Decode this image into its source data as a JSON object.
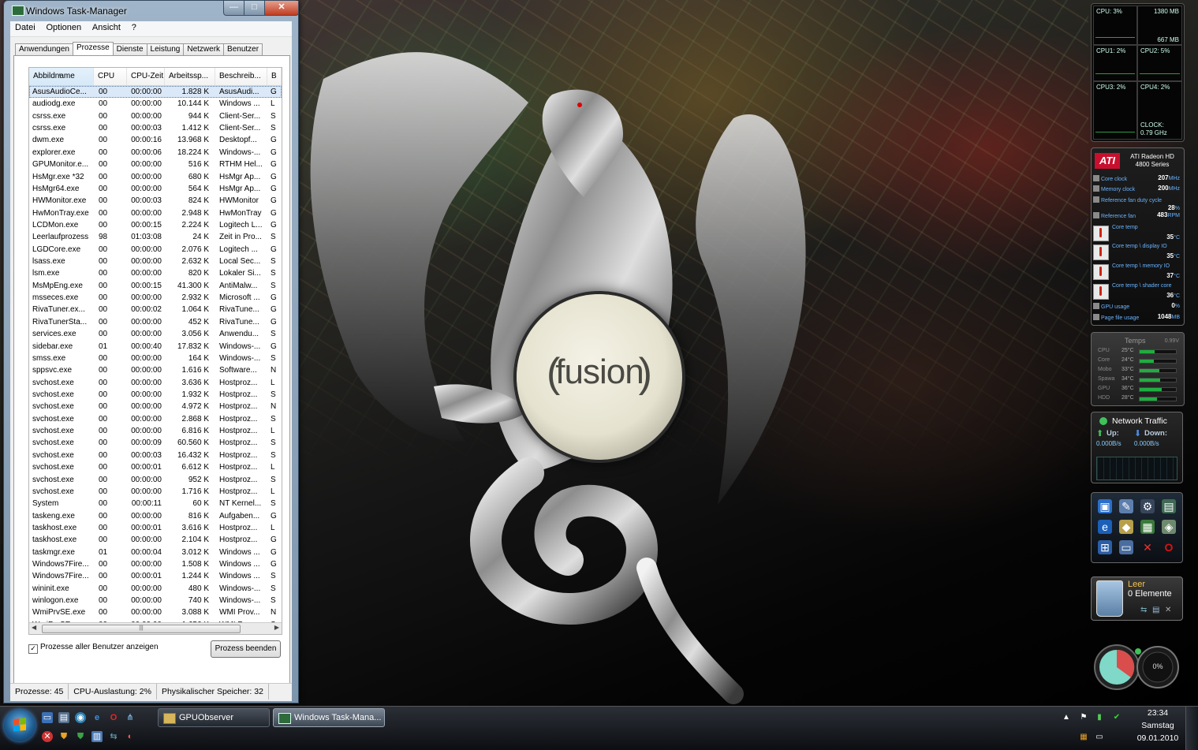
{
  "task_manager": {
    "title": "Windows Task-Manager",
    "title_buttons": {
      "minimize": "—",
      "maximize": "□",
      "close": "✕"
    },
    "menu": [
      "Datei",
      "Optionen",
      "Ansicht",
      "?"
    ],
    "tabs": [
      "Anwendungen",
      "Prozesse",
      "Dienste",
      "Leistung",
      "Netzwerk",
      "Benutzer"
    ],
    "active_tab": "Prozesse",
    "columns": [
      "Abbildname",
      "CPU",
      "CPU-Zeit",
      "Arbeitssp...",
      "Beschreib...",
      "B"
    ],
    "rows": [
      [
        "AsusAudioCe...",
        "00",
        "00:00:00",
        "1.828 K",
        "AsusAudi...",
        "G"
      ],
      [
        "audiodg.exe",
        "00",
        "00:00:00",
        "10.144 K",
        "Windows ...",
        "L"
      ],
      [
        "csrss.exe",
        "00",
        "00:00:00",
        "944 K",
        "Client-Ser...",
        "S"
      ],
      [
        "csrss.exe",
        "00",
        "00:00:03",
        "1.412 K",
        "Client-Ser...",
        "S"
      ],
      [
        "dwm.exe",
        "00",
        "00:00:16",
        "13.968 K",
        "Desktopf...",
        "G"
      ],
      [
        "explorer.exe",
        "00",
        "00:00:06",
        "18.224 K",
        "Windows-...",
        "G"
      ],
      [
        "GPUMonitor.e...",
        "00",
        "00:00:00",
        "516 K",
        "RTHM Hel...",
        "G"
      ],
      [
        "HsMgr.exe *32",
        "00",
        "00:00:00",
        "680 K",
        "HsMgr Ap...",
        "G"
      ],
      [
        "HsMgr64.exe",
        "00",
        "00:00:00",
        "564 K",
        "HsMgr Ap...",
        "G"
      ],
      [
        "HWMonitor.exe",
        "00",
        "00:00:03",
        "824 K",
        "HWMonitor",
        "G"
      ],
      [
        "HwMonTray.exe",
        "00",
        "00:00:00",
        "2.948 K",
        "HwMonTray",
        "G"
      ],
      [
        "LCDMon.exe",
        "00",
        "00:00:15",
        "2.224 K",
        "Logitech L...",
        "G"
      ],
      [
        "Leerlaufprozess",
        "98",
        "01:03:08",
        "24 K",
        "Zeit in Pro...",
        "S"
      ],
      [
        "LGDCore.exe",
        "00",
        "00:00:00",
        "2.076 K",
        "Logitech ...",
        "G"
      ],
      [
        "lsass.exe",
        "00",
        "00:00:00",
        "2.632 K",
        "Local Sec...",
        "S"
      ],
      [
        "lsm.exe",
        "00",
        "00:00:00",
        "820 K",
        "Lokaler Si...",
        "S"
      ],
      [
        "MsMpEng.exe",
        "00",
        "00:00:15",
        "41.300 K",
        "AntiMalw...",
        "S"
      ],
      [
        "msseces.exe",
        "00",
        "00:00:00",
        "2.932 K",
        "Microsoft ...",
        "G"
      ],
      [
        "RivaTuner.ex...",
        "00",
        "00:00:02",
        "1.064 K",
        "RivaTune...",
        "G"
      ],
      [
        "RivaTunerSta...",
        "00",
        "00:00:00",
        "452 K",
        "RivaTune...",
        "G"
      ],
      [
        "services.exe",
        "00",
        "00:00:00",
        "3.056 K",
        "Anwendu...",
        "S"
      ],
      [
        "sidebar.exe",
        "01",
        "00:00:40",
        "17.832 K",
        "Windows-...",
        "G"
      ],
      [
        "smss.exe",
        "00",
        "00:00:00",
        "164 K",
        "Windows-...",
        "S"
      ],
      [
        "sppsvc.exe",
        "00",
        "00:00:00",
        "1.616 K",
        "Software...",
        "N"
      ],
      [
        "svchost.exe",
        "00",
        "00:00:00",
        "3.636 K",
        "Hostproz...",
        "L"
      ],
      [
        "svchost.exe",
        "00",
        "00:00:00",
        "1.932 K",
        "Hostproz...",
        "S"
      ],
      [
        "svchost.exe",
        "00",
        "00:00:00",
        "4.972 K",
        "Hostproz...",
        "N"
      ],
      [
        "svchost.exe",
        "00",
        "00:00:00",
        "2.868 K",
        "Hostproz...",
        "S"
      ],
      [
        "svchost.exe",
        "00",
        "00:00:00",
        "6.816 K",
        "Hostproz...",
        "L"
      ],
      [
        "svchost.exe",
        "00",
        "00:00:09",
        "60.560 K",
        "Hostproz...",
        "S"
      ],
      [
        "svchost.exe",
        "00",
        "00:00:03",
        "16.432 K",
        "Hostproz...",
        "S"
      ],
      [
        "svchost.exe",
        "00",
        "00:00:01",
        "6.612 K",
        "Hostproz...",
        "L"
      ],
      [
        "svchost.exe",
        "00",
        "00:00:00",
        "952 K",
        "Hostproz...",
        "S"
      ],
      [
        "svchost.exe",
        "00",
        "00:00:00",
        "1.716 K",
        "Hostproz...",
        "L"
      ],
      [
        "System",
        "00",
        "00:00:11",
        "60 K",
        "NT Kernel...",
        "S"
      ],
      [
        "taskeng.exe",
        "00",
        "00:00:00",
        "816 K",
        "Aufgaben...",
        "G"
      ],
      [
        "taskhost.exe",
        "00",
        "00:00:01",
        "3.616 K",
        "Hostproz...",
        "L"
      ],
      [
        "taskhost.exe",
        "00",
        "00:00:00",
        "2.104 K",
        "Hostproz...",
        "G"
      ],
      [
        "taskmgr.exe",
        "01",
        "00:00:04",
        "3.012 K",
        "Windows ...",
        "G"
      ],
      [
        "Windows7Fire...",
        "00",
        "00:00:00",
        "1.508 K",
        "Windows ...",
        "G"
      ],
      [
        "Windows7Fire...",
        "00",
        "00:00:01",
        "1.244 K",
        "Windows ...",
        "S"
      ],
      [
        "wininit.exe",
        "00",
        "00:00:00",
        "480 K",
        "Windows-...",
        "S"
      ],
      [
        "winlogon.exe",
        "00",
        "00:00:00",
        "740 K",
        "Windows-...",
        "S"
      ],
      [
        "WmiPrvSE.exe",
        "00",
        "00:00:00",
        "3.088 K",
        "WMI Prov...",
        "N"
      ],
      [
        "WmiPrvSE.exe",
        "00",
        "00:00:00",
        "1.656 K",
        "WMI Prov...",
        "S"
      ]
    ],
    "selected_row": 0,
    "show_all_users_label": "Prozesse aller Benutzer anzeigen",
    "show_all_users_checked": true,
    "end_process_label": "Prozess beenden",
    "status": {
      "processes": "Prozesse: 45",
      "cpu": "CPU-Auslastung: 2%",
      "memory": "Physikalischer Speicher: 32"
    }
  },
  "desktop": {
    "logo_text": "fusion"
  },
  "gadgets": {
    "cpu_meter": {
      "cpu_total": "CPU:   3%",
      "mem": "1380 MB",
      "mem2": "667 MB",
      "cpu1": "CPU1:   2%",
      "cpu2": "CPU2:   5%",
      "cpu3": "CPU3:   2%",
      "cpu4": "CPU4:   2%",
      "clock_label": "CLOCK:",
      "clock_value": "0.79 GHz"
    },
    "ati": {
      "logo": "ATI",
      "name": "ATI Radeon HD",
      "series": "4800 Series",
      "rows": [
        {
          "label": "Core clock",
          "value": "207",
          "unit": "MHz"
        },
        {
          "label": "Memory clock",
          "value": "200",
          "unit": "MHz"
        },
        {
          "label": "Reference fan duty cycle",
          "value": "28",
          "unit": "%"
        },
        {
          "label": "Reference fan",
          "value": "483",
          "unit": "RPM"
        },
        {
          "label": "Core temp",
          "value": "35",
          "unit": "°C"
        },
        {
          "label": "Core temp \\ display IO",
          "value": "35",
          "unit": "°C"
        },
        {
          "label": "Core temp \\ memory IO",
          "value": "37",
          "unit": "°C"
        },
        {
          "label": "Core temp \\ shader core",
          "value": "36",
          "unit": "°C"
        },
        {
          "label": "GPU usage",
          "value": "0",
          "unit": "%"
        },
        {
          "label": "Page file usage",
          "value": "1048",
          "unit": "MB"
        }
      ]
    },
    "temps": {
      "title": "Temps",
      "voltage": "0.99V",
      "rows": [
        {
          "label": "CPU",
          "value": "25°C",
          "level": 0.42
        },
        {
          "label": "Core",
          "value": "24°C",
          "level": 0.4
        },
        {
          "label": "Mobo",
          "value": "33°C",
          "level": 0.55
        },
        {
          "label": "Spawa",
          "value": "34°C",
          "level": 0.57
        },
        {
          "label": "GPU",
          "value": "36°C",
          "level": 0.6
        },
        {
          "label": "HDD",
          "value": "28°C",
          "level": 0.47
        }
      ]
    },
    "network": {
      "title": "Network Traffic",
      "up_label": "Up:",
      "down_label": "Down:",
      "up_value": "0.000B/s",
      "down_value": "0.000B/s"
    },
    "recycle_bin": {
      "title": "Leer",
      "items": "0 Elemente"
    },
    "meter": {
      "value": "0%"
    }
  },
  "taskbar": {
    "buttons": [
      "GPUObserver",
      "Windows Task-Mana..."
    ],
    "active_button": 1,
    "clock": {
      "time": "23:34",
      "day": "Samstag",
      "date": "09.01.2010"
    }
  },
  "colors": {
    "accent_selected_row": "#dbe8f7",
    "ati_red": "#c8102e",
    "temp_bar_green": "#1fae3f",
    "close_button_red": "#c13c1f"
  }
}
